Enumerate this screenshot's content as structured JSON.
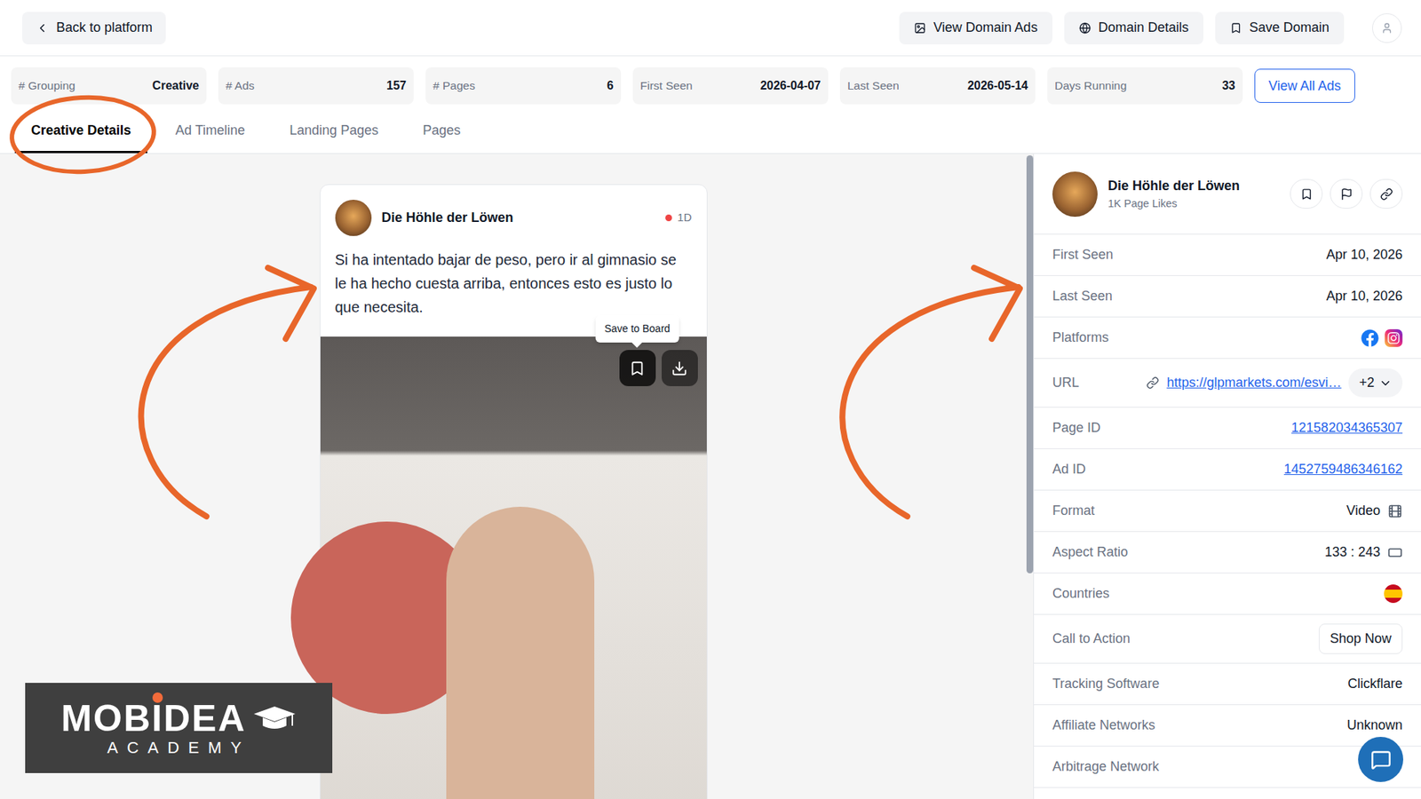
{
  "header": {
    "back": "Back to platform",
    "buttons": [
      "View Domain Ads",
      "Domain Details",
      "Save Domain"
    ]
  },
  "stats": [
    {
      "label": "# Grouping",
      "value": "Creative"
    },
    {
      "label": "# Ads",
      "value": "157"
    },
    {
      "label": "# Pages",
      "value": "6"
    },
    {
      "label": "First Seen",
      "value": "2026-04-07"
    },
    {
      "label": "Last Seen",
      "value": "2026-05-14"
    },
    {
      "label": "Days Running",
      "value": "33"
    }
  ],
  "view_all": "View All Ads",
  "tabs": [
    {
      "label": "Creative Details",
      "selected": true
    },
    {
      "label": "Ad Timeline",
      "selected": false
    },
    {
      "label": "Landing Pages",
      "selected": false
    },
    {
      "label": "Pages",
      "selected": false
    }
  ],
  "ad": {
    "page_name": "Die Höhle der Löwen",
    "age": "1D",
    "text": "Si ha intentado bajar de peso, pero ir al gimnasio se le ha hecho cuesta arriba, entonces esto es justo lo que necesita.",
    "tooltip": "Save to Board"
  },
  "details": {
    "page_name": "Die Höhle der Löwen",
    "likes": "1K Page Likes",
    "rows": [
      {
        "label": "First Seen",
        "value": "Apr 10, 2026",
        "kind": "text"
      },
      {
        "label": "Last Seen",
        "value": "Apr 10, 2026",
        "kind": "text"
      },
      {
        "label": "Platforms",
        "value": "",
        "kind": "platforms"
      },
      {
        "label": "URL",
        "value": "https://glpmarkets.com/esvi…",
        "more": "+2",
        "kind": "link"
      },
      {
        "label": "Page ID",
        "value": "121582034365307",
        "kind": "id"
      },
      {
        "label": "Ad ID",
        "value": "1452759486346162",
        "kind": "id"
      },
      {
        "label": "Format",
        "value": "Video",
        "kind": "format"
      },
      {
        "label": "Aspect Ratio",
        "value": "133 : 243",
        "kind": "ratio"
      },
      {
        "label": "Countries",
        "value": "",
        "kind": "flag"
      },
      {
        "label": "Call to Action",
        "value": "Shop Now",
        "kind": "button"
      },
      {
        "label": "Tracking Software",
        "value": "Clickflare",
        "kind": "text"
      },
      {
        "label": "Affiliate Networks",
        "value": "Unknown",
        "kind": "text"
      },
      {
        "label": "Arbitrage Network",
        "value": "",
        "kind": "covered"
      }
    ]
  },
  "watermark": {
    "brand": "MOBIDEA",
    "sub": "ACADEMY"
  }
}
